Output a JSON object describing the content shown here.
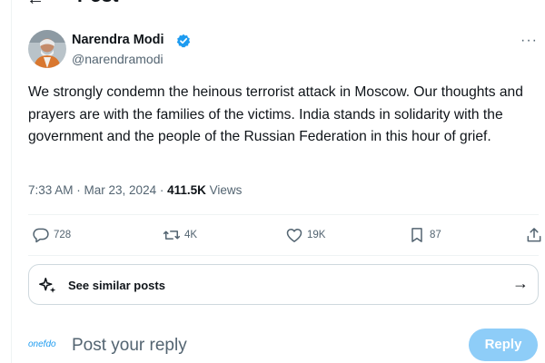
{
  "header": {
    "title": "Post",
    "back_icon": "arrow-left-icon"
  },
  "post": {
    "author": {
      "name": "Narendra Modi",
      "handle": "@narendramodi",
      "verified": true,
      "verified_color": "#1d9bf0"
    },
    "text": "We strongly condemn the heinous terrorist attack in Moscow. Our thoughts and prayers are with the families of the victims. India stands in solidarity with the government and the people of the Russian Federation in this hour of grief.",
    "time": "7:33 AM",
    "separator": " · ",
    "date": "Mar 23, 2024",
    "views_count": "411.5K",
    "views_label": "Views",
    "actions": {
      "replies": "728",
      "reposts": "4K",
      "likes": "19K",
      "bookmarks": "87"
    }
  },
  "similar": {
    "label": "See similar posts",
    "arrow": "→"
  },
  "reply": {
    "avatar_text": "onefdo",
    "placeholder": "Post your reply",
    "button_label": "Reply",
    "button_color": "#8ecdf8"
  }
}
